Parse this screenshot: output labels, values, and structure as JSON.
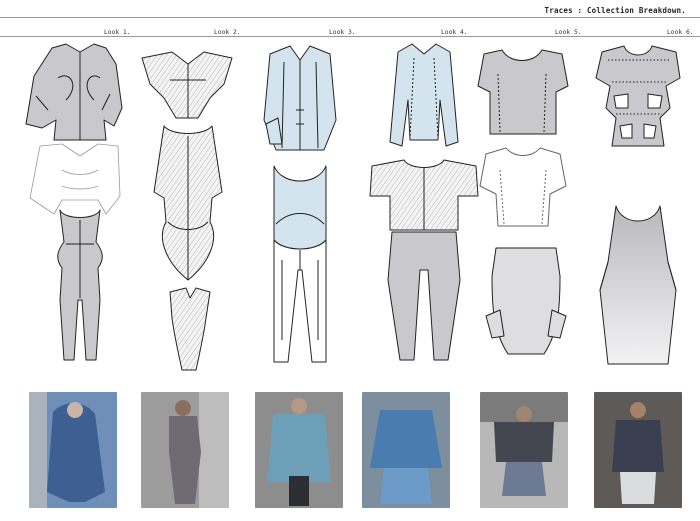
{
  "header": {
    "title": "Traces : Collection Breakdown."
  },
  "looks": [
    {
      "label": "Look 1."
    },
    {
      "label": "Look 2."
    },
    {
      "label": "Look 3."
    },
    {
      "label": "Look 4."
    },
    {
      "label": "Look 5."
    },
    {
      "label": "Look 6."
    }
  ],
  "colors": {
    "grey_fill": "#c9c8cc",
    "blue_fill": "#d4e4ee",
    "light_grey": "#dedde0",
    "line": "#222222"
  }
}
